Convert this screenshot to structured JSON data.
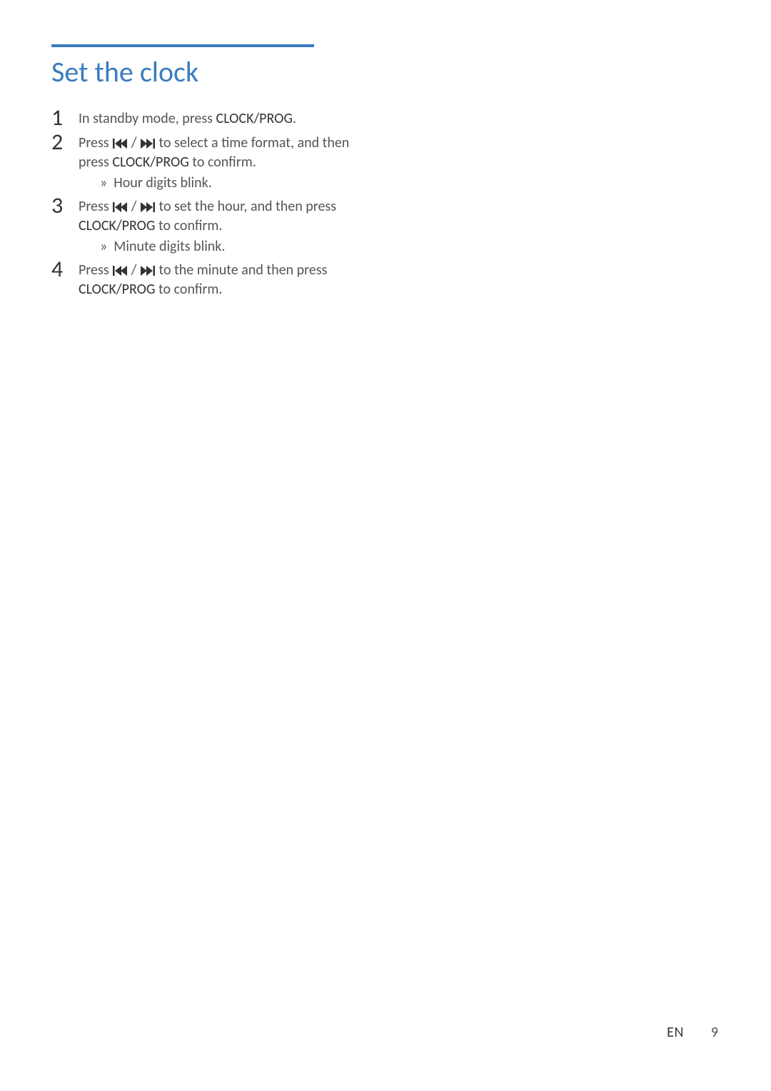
{
  "heading": "Set the clock",
  "steps": {
    "s1": {
      "num": "1",
      "pre": "In standby mode, press ",
      "btn": "CLOCK/PROG",
      "post": "."
    },
    "s2": {
      "num": "2",
      "pre": "Press ",
      "mid": " to select a time format, and then press ",
      "btn": "CLOCK/PROG",
      "post": " to confirm.",
      "sub": "Hour digits blink."
    },
    "s3": {
      "num": "3",
      "pre": "Press ",
      "mid": " to set the hour, and then press ",
      "btn": "CLOCK/PROG",
      "post": " to confirm.",
      "sub": "Minute digits blink."
    },
    "s4": {
      "num": "4",
      "pre": "Press ",
      "mid": " to the minute and then press ",
      "btn": "CLOCK/PROG",
      "post": " to confirm."
    }
  },
  "footer": {
    "lang": "EN",
    "page": "9"
  }
}
